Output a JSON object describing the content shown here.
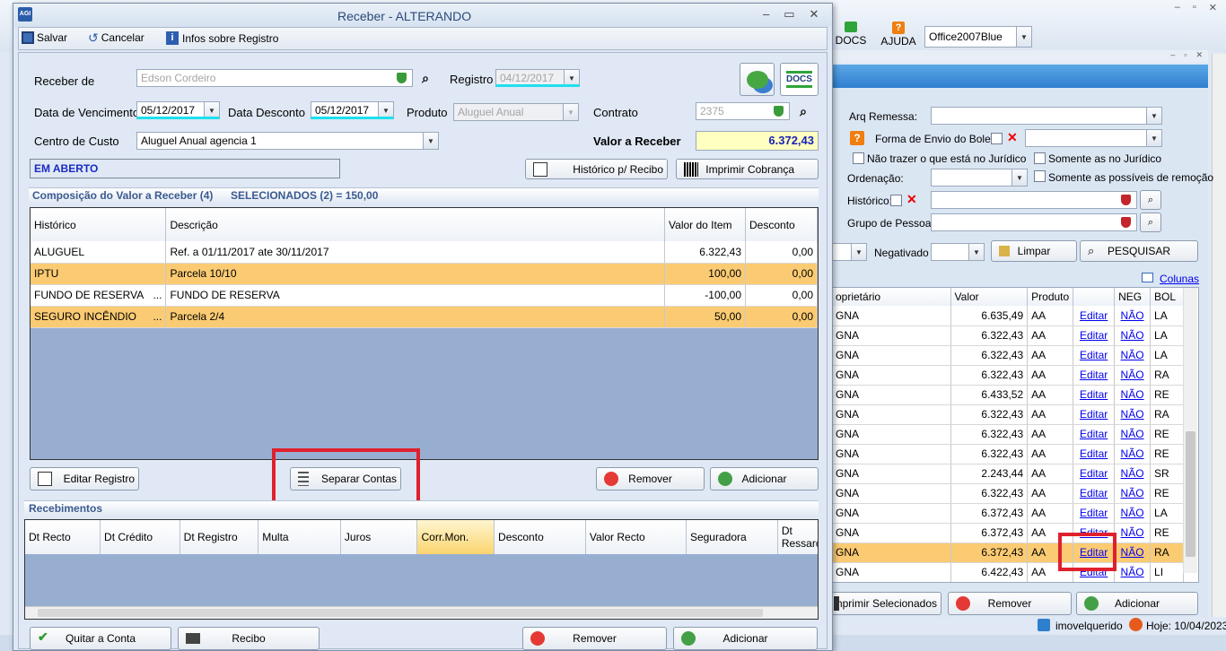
{
  "main_window": {
    "title": "Receber - ALTERANDO",
    "toolbar": {
      "save": "Salvar",
      "cancel": "Cancelar",
      "info": "Infos sobre Registro"
    },
    "form": {
      "receber_de_label": "Receber de",
      "receber_de_value": "Edson Cordeiro",
      "registro_label": "Registro",
      "registro_value": "04/12/2017",
      "vencimento_label": "Data de Vencimento",
      "vencimento_value": "05/12/2017",
      "desconto_label": "Data Desconto",
      "desconto_value": "05/12/2017",
      "produto_label": "Produto",
      "produto_value": "Aluguel Anual",
      "contrato_label": "Contrato",
      "contrato_value": "2375",
      "centro_label": "Centro de Custo",
      "centro_value": "Aluguel Anual agencia 1",
      "valor_label": "Valor a Receber",
      "valor_value": "6.372,43",
      "status": "EM ABERTO"
    },
    "buttons": {
      "historico": "Histórico p/ Recibo",
      "imprimir": "Imprimir Cobrança",
      "editar": "Editar Registro",
      "separar": "Separar Contas",
      "remover": "Remover",
      "adicionar": "Adicionar",
      "quitar": "Quitar a Conta",
      "recibo": "Recibo"
    },
    "composicao": {
      "title": "Composição do Valor a Receber (4)",
      "selected": "SELECIONADOS (2) = 150,00",
      "headers": [
        "Histórico",
        "Descrição",
        "Valor do Item",
        "Desconto"
      ],
      "rows": [
        {
          "hist": "ALUGUEL",
          "desc": "Ref. a 01/11/2017 ate 30/11/2017",
          "valor": "6.322,43",
          "desconto": "0,00",
          "selected": false,
          "dots": ""
        },
        {
          "hist": "IPTU",
          "desc": "Parcela 10/10",
          "valor": "100,00",
          "desconto": "0,00",
          "selected": true,
          "dots": ""
        },
        {
          "hist": "FUNDO DE RESERVA",
          "desc": "FUNDO DE RESERVA",
          "valor": "-100,00",
          "desconto": "0,00",
          "selected": false,
          "dots": "..."
        },
        {
          "hist": "SEGURO INCÊNDIO",
          "desc": "Parcela 2/4",
          "valor": "50,00",
          "desconto": "0,00",
          "selected": true,
          "dots": "..."
        }
      ]
    },
    "recebimentos": {
      "title": "Recebimentos",
      "headers": [
        "Dt Recto",
        "Dt Crédito",
        "Dt Registro",
        "Multa",
        "Juros",
        "Corr.Mon.",
        "Desconto",
        "Valor Recto",
        "Seguradora",
        "Dt Ressarci"
      ]
    }
  },
  "background": {
    "top": {
      "docs": "DOCS",
      "ajuda": "AJUDA",
      "theme": "Office2007Blue"
    },
    "filters": {
      "arq": "Arq Remessa:",
      "forma": "Forma de Envio do Boleto",
      "nao_juridico": "Não trazer o que está no Jurídico",
      "somente_juridico": "Somente as no Jurídico",
      "ordenacao": "Ordenação:",
      "somente_remocao": "Somente as possíveis de remoção",
      "historico": "Histórico:",
      "grupo": "Grupo de Pessoas",
      "negativado": "Negativado",
      "limpar": "Limpar",
      "pesquisar": "PESQUISAR",
      "colunas": "Colunas"
    },
    "grid_headers": [
      "oprietário",
      "Valor",
      "Produto",
      "",
      "NEG",
      "BOL"
    ],
    "rows": [
      {
        "n": "GNA",
        "v": "6.635,49",
        "p": "AA",
        "e": "Editar",
        "neg": "NÃO",
        "b": "LA"
      },
      {
        "n": "GNA",
        "v": "6.322,43",
        "p": "AA",
        "e": "Editar",
        "neg": "NÃO",
        "b": "LA"
      },
      {
        "n": "GNA",
        "v": "6.322,43",
        "p": "AA",
        "e": "Editar",
        "neg": "NÃO",
        "b": "LA"
      },
      {
        "n": "GNA",
        "v": "6.322,43",
        "p": "AA",
        "e": "Editar",
        "neg": "NÃO",
        "b": "RA"
      },
      {
        "n": "GNA",
        "v": "6.433,52",
        "p": "AA",
        "e": "Editar",
        "neg": "NÃO",
        "b": "RE"
      },
      {
        "n": "GNA",
        "v": "6.322,43",
        "p": "AA",
        "e": "Editar",
        "neg": "NÃO",
        "b": "RA"
      },
      {
        "n": "GNA",
        "v": "6.322,43",
        "p": "AA",
        "e": "Editar",
        "neg": "NÃO",
        "b": "RE"
      },
      {
        "n": "GNA",
        "v": "6.322,43",
        "p": "AA",
        "e": "Editar",
        "neg": "NÃO",
        "b": "RE"
      },
      {
        "n": "GNA",
        "v": "2.243,44",
        "p": "AA",
        "e": "Editar",
        "neg": "NÃO",
        "b": "SR"
      },
      {
        "n": "GNA",
        "v": "6.322,43",
        "p": "AA",
        "e": "Editar",
        "neg": "NÃO",
        "b": "RE"
      },
      {
        "n": "GNA",
        "v": "6.372,43",
        "p": "AA",
        "e": "Editar",
        "neg": "NÃO",
        "b": "LA"
      },
      {
        "n": "GNA",
        "v": "6.372,43",
        "p": "AA",
        "e": "Editar",
        "neg": "NÃO",
        "b": "RE"
      },
      {
        "n": "GNA",
        "v": "6.372,43",
        "p": "AA",
        "e": "Editar",
        "neg": "NÃO",
        "b": "RA"
      },
      {
        "n": "GNA",
        "v": "6.422,43",
        "p": "AA",
        "e": "Editar",
        "neg": "NÃO",
        "b": "LI"
      }
    ],
    "bottom": {
      "imprimir_sel": "Imprimir Selecionados",
      "remover": "Remover",
      "adicionar": "Adicionar"
    },
    "status": {
      "user": "imovelquerido",
      "date": "Hoje: 10/04/2023"
    }
  }
}
